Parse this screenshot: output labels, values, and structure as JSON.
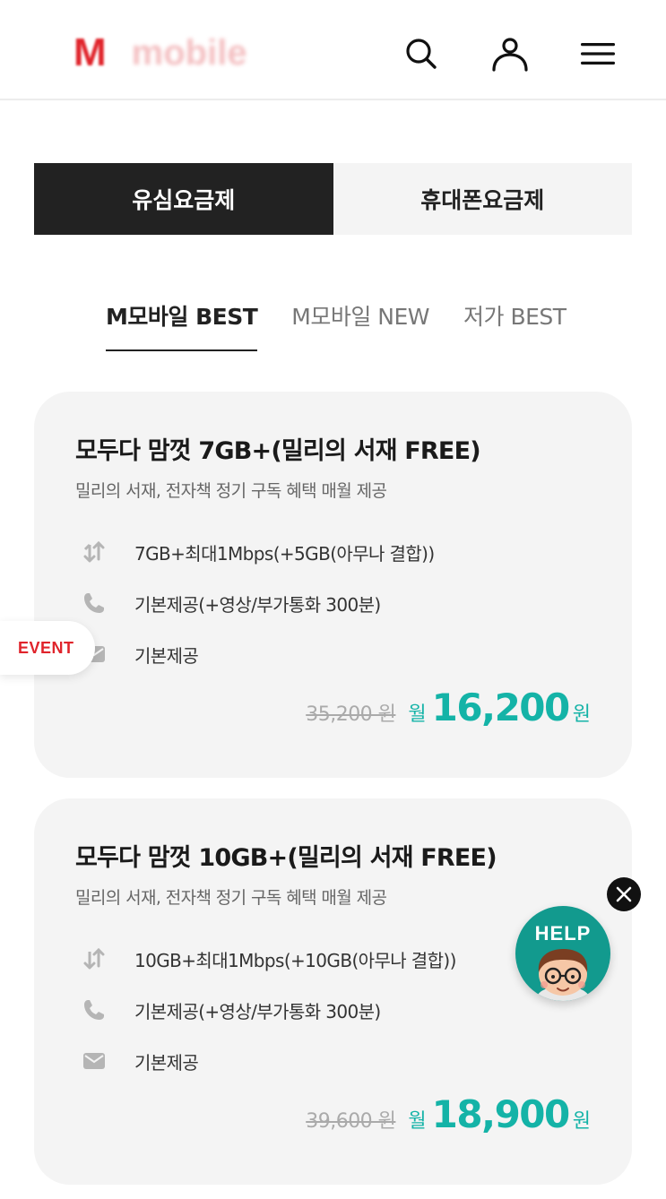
{
  "header": {
    "logo_mark": "M",
    "logo_text": "mobile",
    "icons": [
      "search-icon",
      "user-icon",
      "menu-icon"
    ]
  },
  "type_tabs": [
    {
      "label": "유심요금제",
      "active": true
    },
    {
      "label": "휴대폰요금제",
      "active": false
    }
  ],
  "sub_tabs": [
    {
      "label": "M모바일 BEST",
      "active": true
    },
    {
      "label": "M모바일 NEW",
      "active": false
    },
    {
      "label": "저가 BEST",
      "active": false
    }
  ],
  "plans": [
    {
      "title": "모두다 맘껏 7GB+(밀리의 서재 FREE)",
      "subtitle": "밀리의 서재, 전자책 정기 구독 혜택 매월 제공",
      "data": "7GB+최대1Mbps(+5GB(아무나 결합))",
      "voice": "기본제공(+영상/부가통화 300분)",
      "sms": "기본제공",
      "original_price": "35,200 원",
      "month_label": "월",
      "price": "16,200",
      "won": "원"
    },
    {
      "title": "모두다 맘껏 10GB+(밀리의 서재 FREE)",
      "subtitle": "밀리의 서재, 전자책 정기 구독 혜택 매월 제공",
      "data": "10GB+최대1Mbps(+10GB(아무나 결합))",
      "voice": "기본제공(+영상/부가통화 300분)",
      "sms": "기본제공",
      "original_price": "39,600 원",
      "month_label": "월",
      "price": "18,900",
      "won": "원"
    }
  ],
  "floating": {
    "event_label": "EVENT",
    "help_label": "HELP"
  },
  "colors": {
    "brand_red": "#e0242b",
    "price_teal": "#14b3a7",
    "help_bg": "#129a8e",
    "dark": "#222222"
  }
}
